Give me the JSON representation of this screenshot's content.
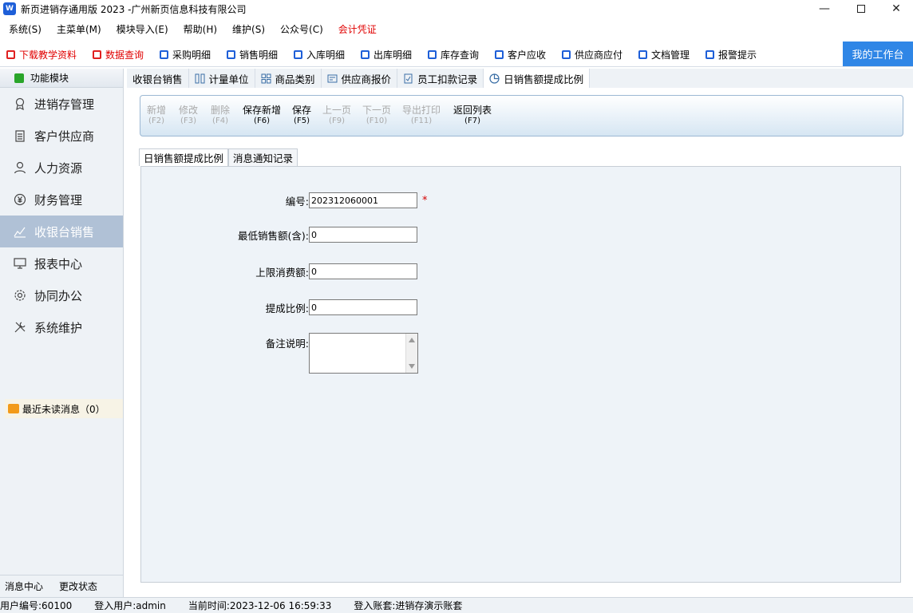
{
  "window": {
    "title": "新页进销存通用版 2023 -广州新页信息科技有限公司",
    "min_symbol": "—",
    "close_symbol": "✕"
  },
  "menu": [
    "系统(S)",
    "主菜单(M)",
    "模块导入(E)",
    "帮助(H)",
    "维护(S)",
    "公众号(C)",
    "会计凭证"
  ],
  "quick": [
    "下载教学资料",
    "数据查询",
    "采购明细",
    "销售明细",
    "入库明细",
    "出库明细",
    "库存查询",
    "客户应收",
    "供应商应付",
    "文档管理",
    "报警提示"
  ],
  "workbench": "我的工作台",
  "sidebar": {
    "header": "功能模块",
    "items": [
      "进销存管理",
      "客户供应商",
      "人力资源",
      "财务管理",
      "收银台销售",
      "报表中心",
      "协同办公",
      "系统维护"
    ],
    "unread": "最近未读消息（0）",
    "footer": [
      "消息中心",
      "更改状态"
    ]
  },
  "tabs": [
    "收银台销售",
    "计量单位",
    "商品类别",
    "供应商报价",
    "员工扣款记录",
    "日销售额提成比例"
  ],
  "actions": [
    {
      "label": "新增",
      "key": "(F2)"
    },
    {
      "label": "修改",
      "key": "(F3)"
    },
    {
      "label": "删除",
      "key": "(F4)"
    },
    {
      "label": "保存新增",
      "key": "(F6)"
    },
    {
      "label": "保存",
      "key": "(F5)"
    },
    {
      "label": "上一页",
      "key": "(F9)"
    },
    {
      "label": "下一页",
      "key": "(F10)"
    },
    {
      "label": "导出打印",
      "key": "(F11)"
    },
    {
      "label": "返回列表",
      "key": "(F7)"
    }
  ],
  "subtabs": [
    "日销售额提成比例",
    "消息通知记录"
  ],
  "form": {
    "code_label": "编号:",
    "code_value": "202312060001",
    "required_mark": "*",
    "min_label": "最低销售额(含):",
    "min_value": "0",
    "max_label": "上限消费额:",
    "max_value": "0",
    "ratio_label": "提成比例:",
    "ratio_value": "0",
    "remark_label": "备注说明:"
  },
  "status": {
    "user_no": "用户编号:60100",
    "login_user": "登入用户:admin",
    "current_time": "当前时间:2023-12-06 16:59:33",
    "account": "登入账套:进销存演示账套"
  },
  "colors": {
    "accent": "#2f86e6",
    "active_side": "#b0c1d6",
    "red": "#e00000"
  }
}
